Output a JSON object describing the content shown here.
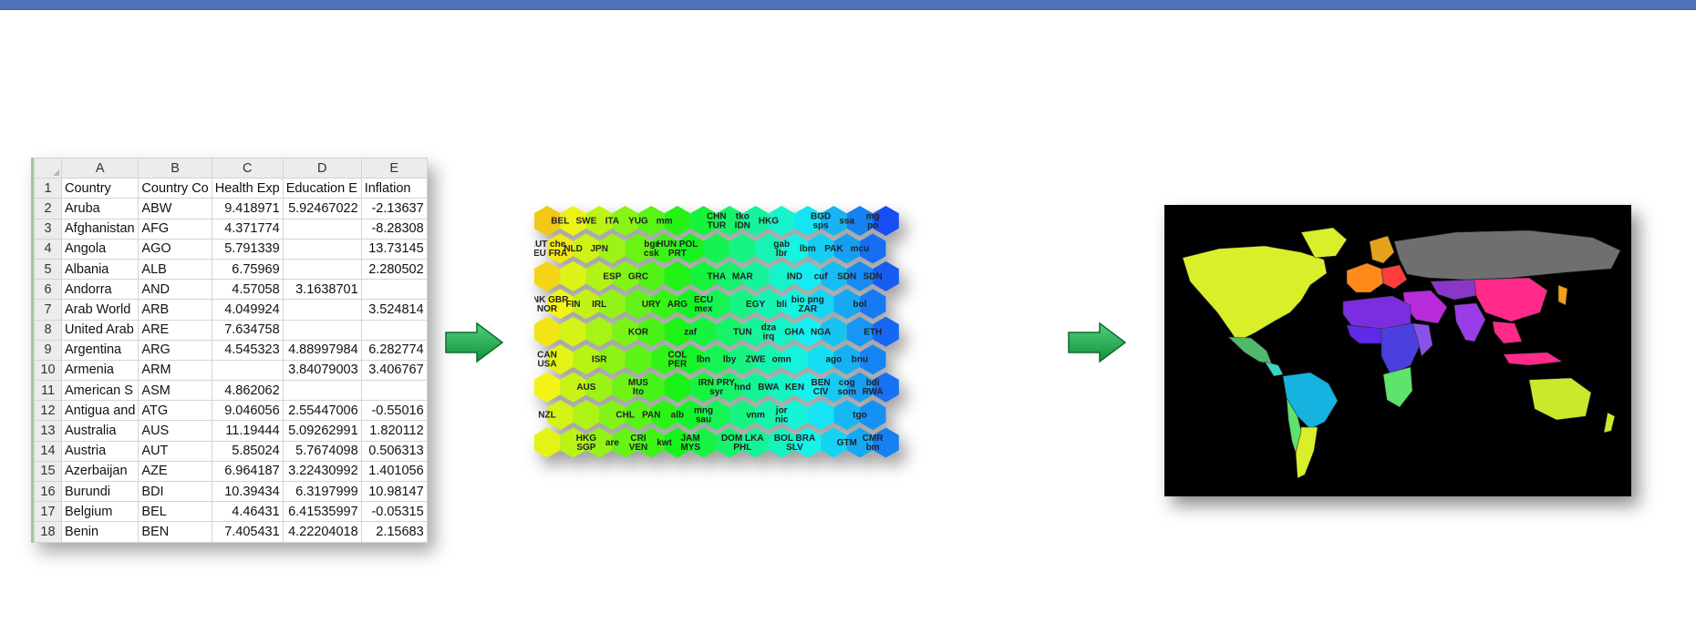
{
  "spreadsheet": {
    "columns": [
      "A",
      "B",
      "C",
      "D",
      "E"
    ],
    "rows": [
      {
        "n": "1",
        "cells": [
          "Country",
          "Country Co",
          "Health Exp",
          "Education E",
          "Inflation"
        ]
      },
      {
        "n": "2",
        "cells": [
          "Aruba",
          "ABW",
          "9.418971",
          "5.92467022",
          "-2.13637"
        ]
      },
      {
        "n": "3",
        "cells": [
          "Afghanistan",
          "AFG",
          "4.371774",
          "",
          "-8.28308"
        ]
      },
      {
        "n": "4",
        "cells": [
          "Angola",
          "AGO",
          "5.791339",
          "",
          "13.73145"
        ]
      },
      {
        "n": "5",
        "cells": [
          "Albania",
          "ALB",
          "6.75969",
          "",
          "2.280502"
        ]
      },
      {
        "n": "6",
        "cells": [
          "Andorra",
          "AND",
          "4.57058",
          "3.1638701",
          ""
        ]
      },
      {
        "n": "7",
        "cells": [
          "Arab World",
          "ARB",
          "4.049924",
          "",
          "3.524814"
        ]
      },
      {
        "n": "8",
        "cells": [
          "United Arab",
          "ARE",
          "7.634758",
          "",
          ""
        ]
      },
      {
        "n": "9",
        "cells": [
          "Argentina",
          "ARG",
          "4.545323",
          "4.88997984",
          "6.282774"
        ]
      },
      {
        "n": "10",
        "cells": [
          "Armenia",
          "ARM",
          "",
          "3.84079003",
          "3.406767"
        ]
      },
      {
        "n": "11",
        "cells": [
          "American S",
          "ASM",
          "4.862062",
          "",
          ""
        ]
      },
      {
        "n": "12",
        "cells": [
          "Antigua and",
          "ATG",
          "9.046056",
          "2.55447006",
          "-0.55016"
        ]
      },
      {
        "n": "13",
        "cells": [
          "Australia",
          "AUS",
          "11.19444",
          "5.09262991",
          "1.820112"
        ]
      },
      {
        "n": "14",
        "cells": [
          "Austria",
          "AUT",
          "5.85024",
          "5.7674098",
          "0.506313"
        ]
      },
      {
        "n": "15",
        "cells": [
          "Azerbaijan",
          "AZE",
          "6.964187",
          "3.22430992",
          "1.401056"
        ]
      },
      {
        "n": "16",
        "cells": [
          "Burundi",
          "BDI",
          "10.39434",
          "6.3197999",
          "10.98147"
        ]
      },
      {
        "n": "17",
        "cells": [
          "Belgium",
          "BEL",
          "4.46431",
          "6.41535997",
          "-0.05315"
        ]
      },
      {
        "n": "18",
        "cells": [
          "Benin",
          "BEN",
          "7.405431",
          "4.22204018",
          "2.15683"
        ]
      }
    ]
  },
  "hexmap": {
    "cols": 20,
    "rows": 12,
    "labels": [
      {
        "col": 1,
        "row": 0,
        "text": "BEL"
      },
      {
        "col": 3,
        "row": 0,
        "text": "SWE"
      },
      {
        "col": 5,
        "row": 0,
        "text": "ITA"
      },
      {
        "col": 7,
        "row": 0,
        "text": "YUG"
      },
      {
        "col": 9,
        "row": 0,
        "text": "mm"
      },
      {
        "col": 13,
        "row": 0,
        "text": "CHN TUR"
      },
      {
        "col": 15,
        "row": 0,
        "text": "tko IDN"
      },
      {
        "col": 17,
        "row": 0,
        "text": "HKG"
      },
      {
        "col": 21,
        "row": 0,
        "text": "BGD sps"
      },
      {
        "col": 23,
        "row": 0,
        "text": "ssa"
      },
      {
        "col": 25,
        "row": 0,
        "text": "mg po"
      },
      {
        "col": 0,
        "row": 1,
        "text": "AUT che DEU FRA"
      },
      {
        "col": 2,
        "row": 1,
        "text": "NLD"
      },
      {
        "col": 4,
        "row": 1,
        "text": "JPN"
      },
      {
        "col": 8,
        "row": 1,
        "text": "bgr csk"
      },
      {
        "col": 10,
        "row": 1,
        "text": "HUN POL PRT"
      },
      {
        "col": 18,
        "row": 1,
        "text": "gab lbr"
      },
      {
        "col": 20,
        "row": 1,
        "text": "lbm"
      },
      {
        "col": 22,
        "row": 1,
        "text": "PAK"
      },
      {
        "col": 24,
        "row": 1,
        "text": "mcu"
      },
      {
        "col": 5,
        "row": 2,
        "text": "ESP"
      },
      {
        "col": 7,
        "row": 2,
        "text": "GRC"
      },
      {
        "col": 13,
        "row": 2,
        "text": "THA"
      },
      {
        "col": 15,
        "row": 2,
        "text": "MAR"
      },
      {
        "col": 19,
        "row": 2,
        "text": "IND"
      },
      {
        "col": 21,
        "row": 2,
        "text": "cuf"
      },
      {
        "col": 23,
        "row": 2,
        "text": "SDN"
      },
      {
        "col": 25,
        "row": 2,
        "text": "SDN"
      },
      {
        "col": 0,
        "row": 3,
        "text": "DNK GBR NOR"
      },
      {
        "col": 2,
        "row": 3,
        "text": "FIN"
      },
      {
        "col": 4,
        "row": 3,
        "text": "IRL"
      },
      {
        "col": 8,
        "row": 3,
        "text": "URY"
      },
      {
        "col": 10,
        "row": 3,
        "text": "ARG"
      },
      {
        "col": 12,
        "row": 3,
        "text": "ECU mex"
      },
      {
        "col": 16,
        "row": 3,
        "text": "EGY"
      },
      {
        "col": 18,
        "row": 3,
        "text": "bli"
      },
      {
        "col": 20,
        "row": 3,
        "text": "bio png ZAR"
      },
      {
        "col": 24,
        "row": 3,
        "text": "bol"
      },
      {
        "col": 7,
        "row": 4,
        "text": "KOR"
      },
      {
        "col": 11,
        "row": 4,
        "text": "zaf"
      },
      {
        "col": 15,
        "row": 4,
        "text": "TUN"
      },
      {
        "col": 17,
        "row": 4,
        "text": "dza irq"
      },
      {
        "col": 19,
        "row": 4,
        "text": "GHA"
      },
      {
        "col": 21,
        "row": 4,
        "text": "NGA"
      },
      {
        "col": 25,
        "row": 4,
        "text": "ETH"
      },
      {
        "col": 0,
        "row": 5,
        "text": "CAN USA"
      },
      {
        "col": 4,
        "row": 5,
        "text": "ISR"
      },
      {
        "col": 10,
        "row": 5,
        "text": "COL PER"
      },
      {
        "col": 12,
        "row": 5,
        "text": "lbn"
      },
      {
        "col": 14,
        "row": 5,
        "text": "lby"
      },
      {
        "col": 16,
        "row": 5,
        "text": "ZWE"
      },
      {
        "col": 18,
        "row": 5,
        "text": "omn"
      },
      {
        "col": 22,
        "row": 5,
        "text": "ago"
      },
      {
        "col": 24,
        "row": 5,
        "text": "bnu"
      },
      {
        "col": 3,
        "row": 6,
        "text": "AUS"
      },
      {
        "col": 7,
        "row": 6,
        "text": "MUS lto"
      },
      {
        "col": 13,
        "row": 6,
        "text": "IRN PRY syr"
      },
      {
        "col": 15,
        "row": 6,
        "text": "hnd"
      },
      {
        "col": 17,
        "row": 6,
        "text": "BWA"
      },
      {
        "col": 19,
        "row": 6,
        "text": "KEN"
      },
      {
        "col": 21,
        "row": 6,
        "text": "BEN CIV"
      },
      {
        "col": 23,
        "row": 6,
        "text": "cog som"
      },
      {
        "col": 25,
        "row": 6,
        "text": "bdi RWA"
      },
      {
        "col": 0,
        "row": 7,
        "text": "NZL"
      },
      {
        "col": 6,
        "row": 7,
        "text": "CHL"
      },
      {
        "col": 8,
        "row": 7,
        "text": "PAN"
      },
      {
        "col": 10,
        "row": 7,
        "text": "alb"
      },
      {
        "col": 12,
        "row": 7,
        "text": "mng sau"
      },
      {
        "col": 16,
        "row": 7,
        "text": "vnm"
      },
      {
        "col": 18,
        "row": 7,
        "text": "jor nic"
      },
      {
        "col": 24,
        "row": 7,
        "text": "tgo"
      },
      {
        "col": 3,
        "row": 8,
        "text": "HKG SGP"
      },
      {
        "col": 5,
        "row": 8,
        "text": "are"
      },
      {
        "col": 7,
        "row": 8,
        "text": "CRI VEN"
      },
      {
        "col": 9,
        "row": 8,
        "text": "kwt"
      },
      {
        "col": 11,
        "row": 8,
        "text": "JAM MYS"
      },
      {
        "col": 15,
        "row": 8,
        "text": "DOM LKA PHL"
      },
      {
        "col": 19,
        "row": 8,
        "text": "BOL BRA SLV"
      },
      {
        "col": 23,
        "row": 8,
        "text": "GTM"
      },
      {
        "col": 25,
        "row": 8,
        "text": "CMR bm"
      }
    ]
  }
}
